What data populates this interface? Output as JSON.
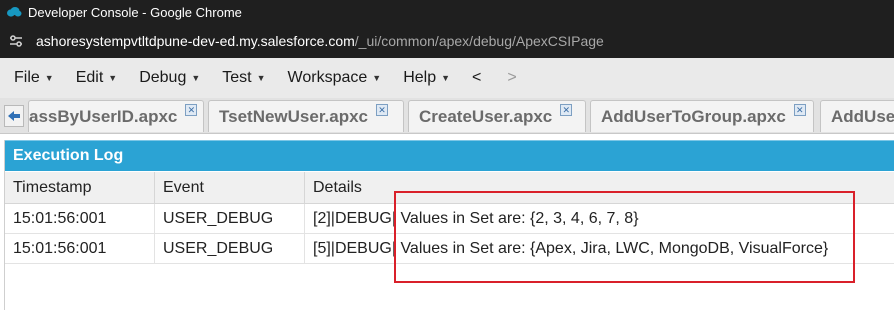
{
  "browser": {
    "window_title": "Developer Console - Google Chrome",
    "url_host": "ashoresystempvtltdpune-dev-ed.my.salesforce.com",
    "url_path": "/_ui/common/apex/debug/ApexCSIPage"
  },
  "menu": {
    "items": [
      {
        "label": "File"
      },
      {
        "label": "Edit"
      },
      {
        "label": "Debug"
      },
      {
        "label": "Test"
      },
      {
        "label": "Workspace"
      },
      {
        "label": "Help"
      }
    ],
    "back_label": "<",
    "forward_label": ">"
  },
  "tabs": [
    {
      "label": "assByUserID.apxc"
    },
    {
      "label": "TsetNewUser.apxc"
    },
    {
      "label": "CreateUser.apxc"
    },
    {
      "label": "AddUserToGroup.apxc"
    },
    {
      "label": "AddUse"
    }
  ],
  "log": {
    "title": "Execution Log",
    "columns": [
      "Timestamp",
      "Event",
      "Details"
    ],
    "rows": [
      {
        "timestamp": "15:01:56:001",
        "event": "USER_DEBUG",
        "details": "[2]|DEBUG| Values in Set are: {2, 3, 4, 6, 7, 8}"
      },
      {
        "timestamp": "15:01:56:001",
        "event": "USER_DEBUG",
        "details": "[5]|DEBUG| Values in Set are: {Apex, Jira, LWC, MongoDB, VisualForce}"
      }
    ]
  },
  "colors": {
    "panel_header": "#2ba3d4",
    "highlight_border": "#d9202a",
    "titlebar_bg": "#1f1f1f"
  },
  "icons": {
    "title": "salesforce-cloud-icon",
    "site_info": "site-settings-icon",
    "tab_back": "back-arrow-icon",
    "tab_close": "close-icon"
  }
}
